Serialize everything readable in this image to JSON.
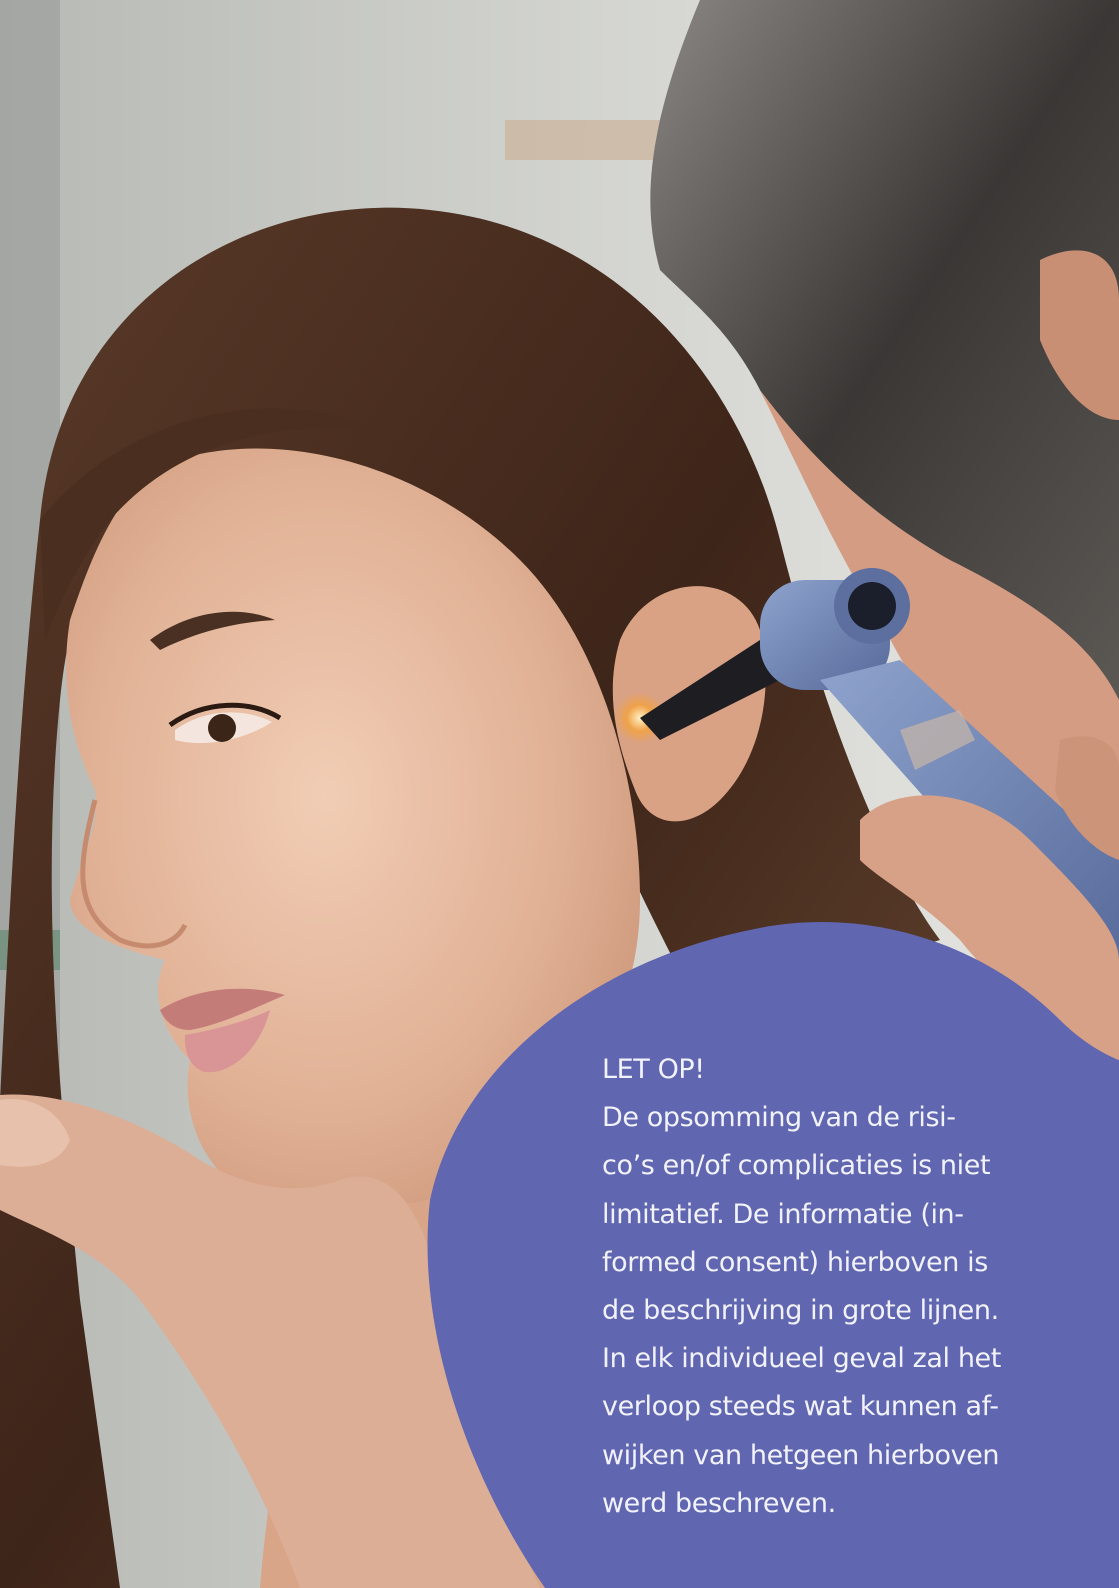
{
  "photo": {
    "description_icon": "doctor-otoscope-ear-exam-photo",
    "colors": {
      "backdrop": "#c9c9c4",
      "skin": "#e3b79c",
      "hair_woman": "#4b3022",
      "hair_man": "#3f3b38",
      "otoscope": "#6f85b4",
      "accent_blob": "#6066b0"
    }
  },
  "notice": {
    "lines": [
      "LET OP!",
      "De opsomming van de risi-",
      "co’s en/of complicaties is niet",
      "limitatief. De informatie (in-",
      "formed consent) hierboven is",
      "de beschrijving in grote lijnen.",
      "In elk individueel geval zal het",
      "verloop steeds wat kunnen af-",
      "wijken van hetgeen hierboven",
      "werd beschreven."
    ]
  }
}
